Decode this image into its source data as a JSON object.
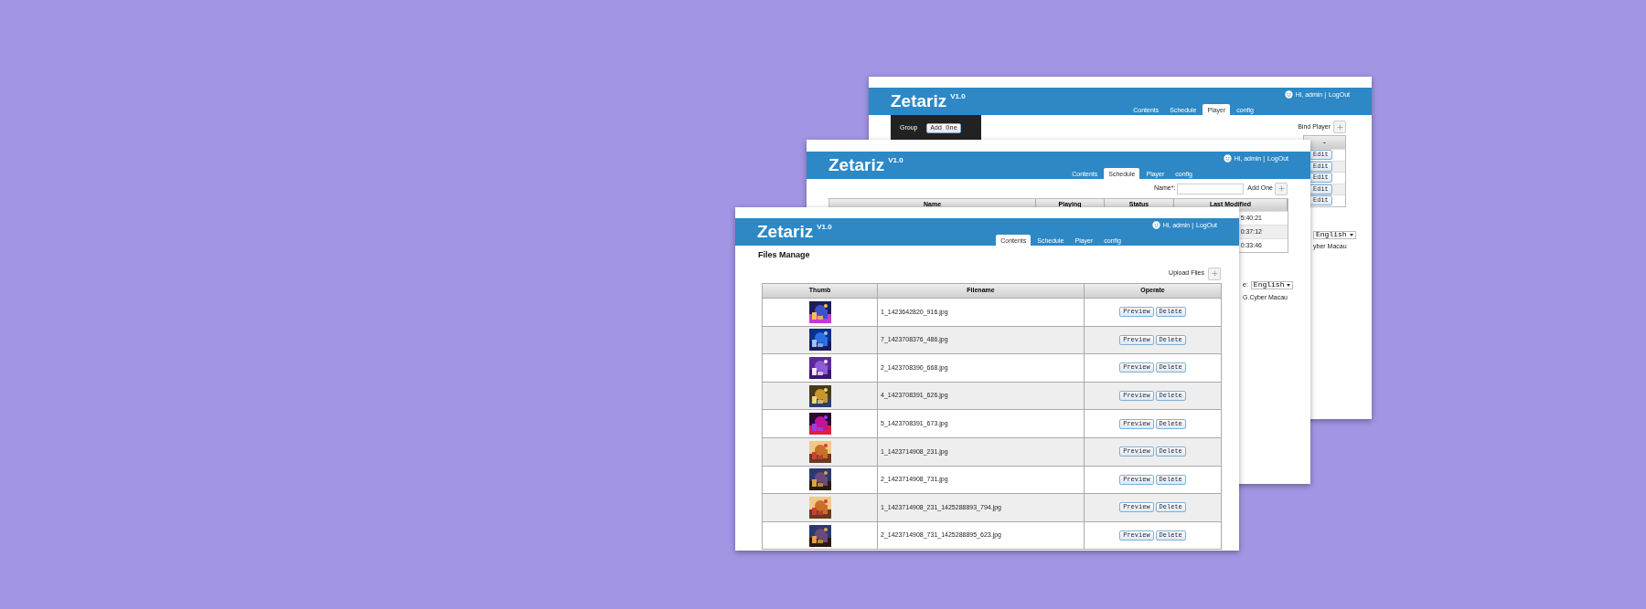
{
  "windows": [
    {
      "kind": "player",
      "logo": "Zetariz",
      "version": "V1.0",
      "greeting": "Hi, admin |",
      "logout": "LogOut",
      "tabs": [
        {
          "label": "Contents",
          "selected": false
        },
        {
          "label": "Schedule",
          "selected": false
        },
        {
          "label": "Player",
          "selected": true
        },
        {
          "label": "config",
          "selected": false
        }
      ],
      "group_label": "Group",
      "add_group_button": "Add One",
      "bind_player": "Bind Player",
      "table": {
        "column_8": "-",
        "rows": [
          {
            "action": "Edit"
          },
          {
            "action": "Edit"
          },
          {
            "action": "Edit"
          },
          {
            "action": "Edit"
          },
          {
            "action": "Edit"
          }
        ]
      },
      "language_select": "English",
      "footer_text": "yber Macau"
    },
    {
      "kind": "schedule",
      "logo": "Zetariz",
      "version": "V1.0",
      "greeting": "Hi, admin |",
      "logout": "LogOut",
      "tabs": [
        {
          "label": "Contents",
          "selected": false
        },
        {
          "label": "Schedule",
          "selected": true
        },
        {
          "label": "Player",
          "selected": false
        },
        {
          "label": "config",
          "selected": false
        }
      ],
      "name_label": "Name*:",
      "add_button": "Add One",
      "table": {
        "columns": [
          "Name",
          "Playing",
          "Status",
          "Last Modified"
        ],
        "rows": [
          {
            "last_modified": "5:40:21"
          },
          {
            "last_modified": "0:37:12"
          },
          {
            "last_modified": "0:33:46"
          }
        ]
      },
      "language_label": "e:",
      "language_select": "English",
      "footer_text": "G.Cyber Macau"
    },
    {
      "kind": "contents",
      "logo": "Zetariz",
      "version": "V1.0",
      "greeting": "Hi, admin |",
      "logout": "LogOut",
      "tabs": [
        {
          "label": "Contents",
          "selected": true
        },
        {
          "label": "Schedule",
          "selected": false
        },
        {
          "label": "Player",
          "selected": false
        },
        {
          "label": "config",
          "selected": false
        }
      ],
      "page_title": "Files Manage",
      "upload_button": "Upload Files",
      "table": {
        "columns": [
          "Thumb",
          "Filename",
          "Operate"
        ],
        "rows": [
          {
            "thumb": {
              "kind": "picture"
            },
            "filename": "1_1423642820_916.jpg",
            "actions": [
              "Preview",
              "Delete"
            ]
          },
          {
            "thumb": {
              "kind": "picture"
            },
            "filename": "7_1423708376_486.jpg",
            "actions": [
              "Preview",
              "Delete"
            ]
          },
          {
            "thumb": {
              "kind": "picture"
            },
            "filename": "2_1423708390_668.jpg",
            "actions": [
              "Preview",
              "Delete"
            ]
          },
          {
            "thumb": {
              "kind": "picture"
            },
            "filename": "4_1423708391_626.jpg",
            "actions": [
              "Preview",
              "Delete"
            ]
          },
          {
            "thumb": {
              "kind": "picture"
            },
            "filename": "5_1423708391_673.jpg",
            "actions": [
              "Preview",
              "Delete"
            ]
          },
          {
            "thumb": {
              "kind": "picture"
            },
            "filename": "1_1423714908_231.jpg",
            "actions": [
              "Preview",
              "Delete"
            ]
          },
          {
            "thumb": {
              "kind": "picture"
            },
            "filename": "2_1423714908_731.jpg",
            "actions": [
              "Preview",
              "Delete"
            ]
          },
          {
            "thumb": {
              "kind": "picture"
            },
            "filename": "1_1423714908_231_1425288893_794.jpg",
            "actions": [
              "Preview",
              "Delete"
            ]
          },
          {
            "thumb": {
              "kind": "picture"
            },
            "filename": "2_1423714908_731_1425288895_623.jpg",
            "actions": [
              "Preview",
              "Delete"
            ]
          }
        ]
      }
    }
  ]
}
